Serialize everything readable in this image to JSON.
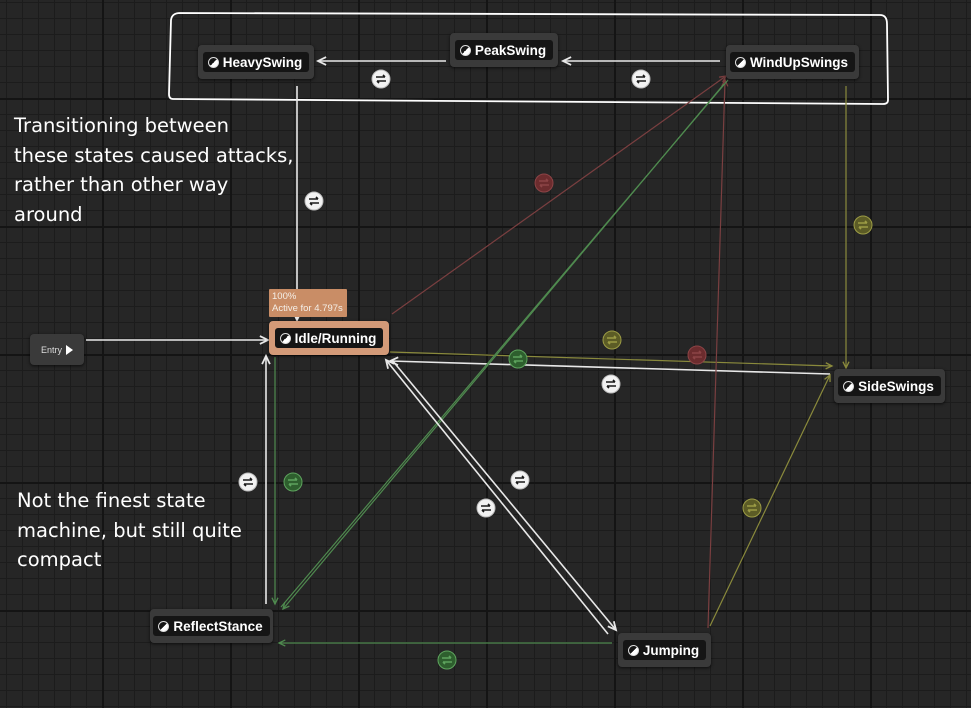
{
  "entry": {
    "label": "Entry"
  },
  "states": {
    "heavy_swing": "HeavySwing",
    "peak_swing": "PeakSwing",
    "wind_up_swings": "WindUpSwings",
    "idle_running": "Idle/Running",
    "side_swings": "SideSwings",
    "reflect_stance": "ReflectStance",
    "jumping": "Jumping"
  },
  "active_badge": {
    "percent": "100%",
    "duration": "Active for 4.797s"
  },
  "annotations": {
    "top_note_lines": [
      "Transitioning between",
      "these states caused attacks,",
      "rather than other way",
      "around"
    ],
    "bottom_note_lines": [
      "Not the finest state",
      "machine, but still quite",
      "compact"
    ]
  },
  "colors": {
    "wire_active": "#e8e8e8",
    "wire_green": "#4f8a4f",
    "wire_olive": "#8a8a3c",
    "wire_red": "#7a3f40",
    "active_state": "#d39a78",
    "highlight_outline": "#ffffff"
  },
  "icons": {
    "state": "state-half-circle-icon",
    "transition": "transition-arrows-icon",
    "entry": "play-arrow-icon"
  }
}
